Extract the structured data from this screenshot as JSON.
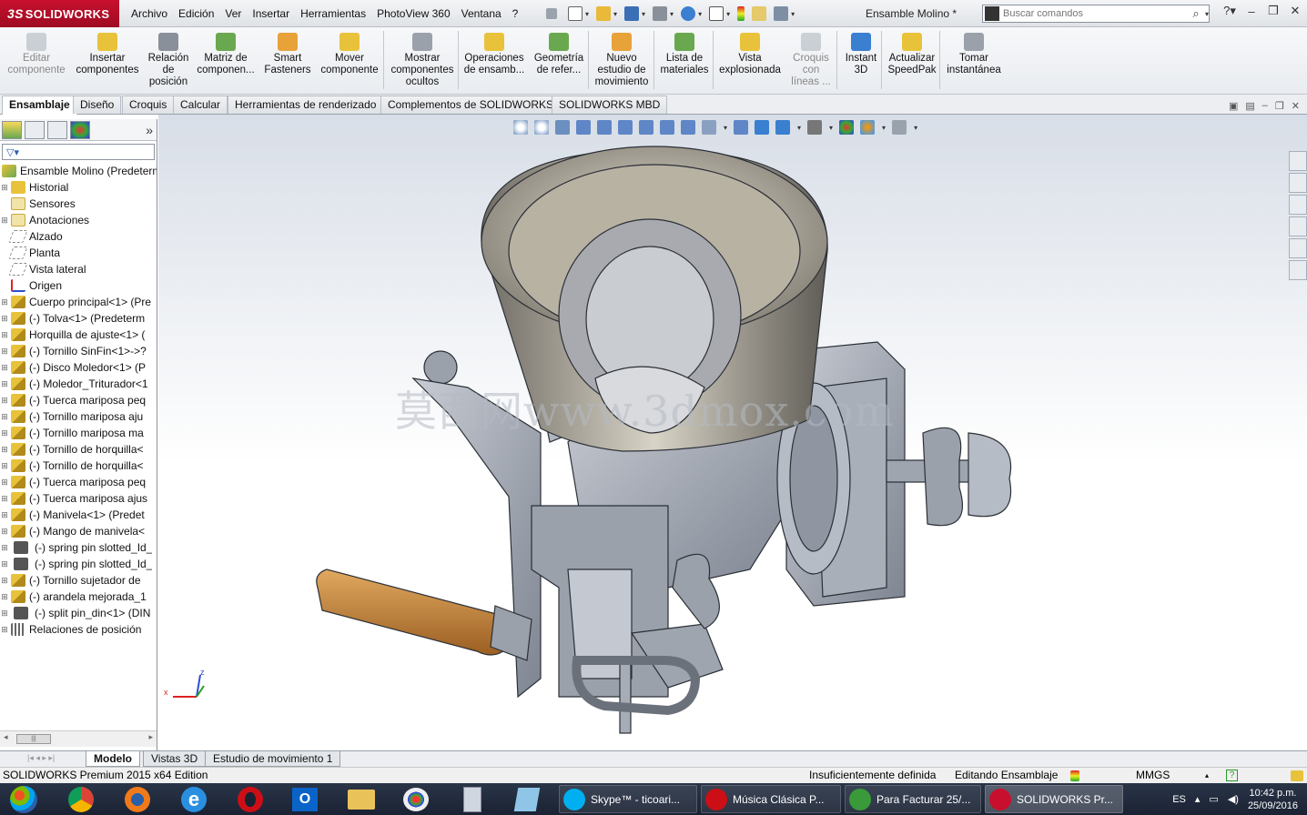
{
  "app": {
    "brand": "SOLIDWORKS",
    "brand_prefix": "3S",
    "document_title": "Ensamble Molino *"
  },
  "menus": [
    "Archivo",
    "Edición",
    "Ver",
    "Insertar",
    "Herramientas",
    "PhotoView 360",
    "Ventana",
    "?"
  ],
  "search": {
    "placeholder": "Buscar comandos"
  },
  "ribbon": [
    {
      "label": "Editar\ncomponente",
      "disabled": true,
      "icon": "edit-component-icon"
    },
    {
      "label": "Insertar\ncomponentes",
      "icon": "insert-components-icon"
    },
    {
      "label": "Relación\nde\nposición",
      "icon": "mate-icon"
    },
    {
      "label": "Matriz de\ncomponen...",
      "icon": "component-pattern-icon"
    },
    {
      "label": "Smart\nFasteners",
      "icon": "smart-fasteners-icon"
    },
    {
      "label": "Mover\ncomponente",
      "icon": "move-component-icon"
    },
    {
      "label": "Mostrar\ncomponentes\nocultos",
      "icon": "show-hidden-icon"
    },
    {
      "label": "Operaciones\nde ensamb...",
      "icon": "assembly-features-icon"
    },
    {
      "label": "Geometría\nde refer...",
      "icon": "reference-geometry-icon"
    },
    {
      "label": "Nuevo\nestudio de\nmovimiento",
      "icon": "motion-study-icon"
    },
    {
      "label": "Lista de\nmateriales",
      "icon": "bom-icon"
    },
    {
      "label": "Vista\nexplosionada",
      "icon": "exploded-view-icon"
    },
    {
      "label": "Croquis\ncon\nlíneas ...",
      "disabled": true,
      "icon": "explode-line-sketch-icon"
    },
    {
      "label": "Instant\n3D",
      "icon": "instant3d-icon"
    },
    {
      "label": "Actualizar\nSpeedPak",
      "icon": "speedpak-icon"
    },
    {
      "label": "Tomar\ninstantánea",
      "icon": "snapshot-icon"
    }
  ],
  "tabs": [
    "Ensamblaje",
    "Diseño",
    "Croquis",
    "Calcular",
    "Herramientas de renderizado",
    "Complementos de SOLIDWORKS",
    "SOLIDWORKS MBD"
  ],
  "feature_tree": {
    "root": "Ensamble Molino  (Predeterm",
    "items": [
      {
        "label": "Historial",
        "icon": "history-icon",
        "expand": true
      },
      {
        "label": "Sensores",
        "icon": "sensors-icon",
        "expand": false
      },
      {
        "label": "Anotaciones",
        "icon": "annotations-icon",
        "expand": true
      },
      {
        "label": "Alzado",
        "icon": "plane-icon",
        "expand": false
      },
      {
        "label": "Planta",
        "icon": "plane-icon",
        "expand": false
      },
      {
        "label": "Vista lateral",
        "icon": "plane-icon",
        "expand": false
      },
      {
        "label": "Origen",
        "icon": "origin-icon",
        "expand": false
      },
      {
        "label": "Cuerpo principal<1> (Pre",
        "icon": "part-icon",
        "expand": true
      },
      {
        "label": "(-) Tolva<1> (Predeterm",
        "icon": "part-icon",
        "expand": true
      },
      {
        "label": "Horquilla de ajuste<1> (",
        "icon": "part-icon",
        "expand": true
      },
      {
        "label": "(-) Tornillo SinFin<1>->?",
        "icon": "part-icon",
        "expand": true
      },
      {
        "label": "(-) Disco Moledor<1> (P",
        "icon": "part-icon",
        "expand": true
      },
      {
        "label": "(-) Moledor_Triturador<1",
        "icon": "part-icon",
        "expand": true
      },
      {
        "label": "(-) Tuerca mariposa peq",
        "icon": "part-icon",
        "expand": true
      },
      {
        "label": "(-) Tornillo mariposa aju",
        "icon": "part-icon",
        "expand": true
      },
      {
        "label": "(-) Tornillo mariposa ma",
        "icon": "part-icon",
        "expand": true
      },
      {
        "label": "(-) Tornillo de horquilla<",
        "icon": "part-icon",
        "expand": true
      },
      {
        "label": "(-) Tornillo de horquilla<",
        "icon": "part-icon",
        "expand": true
      },
      {
        "label": "(-) Tuerca mariposa peq",
        "icon": "part-icon",
        "expand": true
      },
      {
        "label": "(-) Tuerca mariposa ajus",
        "icon": "part-icon",
        "expand": true
      },
      {
        "label": "(-) Manivela<1> (Predet",
        "icon": "part-icon",
        "expand": true
      },
      {
        "label": "(-) Mango de manivela<",
        "icon": "part-icon",
        "expand": true
      },
      {
        "label": "(-) spring pin slotted_Id_",
        "icon": "toolbox-part-icon",
        "expand": true
      },
      {
        "label": "(-) spring pin slotted_Id_",
        "icon": "toolbox-part-icon",
        "expand": true
      },
      {
        "label": "(-) Tornillo sujetador de",
        "icon": "part-icon",
        "expand": true
      },
      {
        "label": "(-) arandela  mejorada_1",
        "icon": "part-icon",
        "expand": true
      },
      {
        "label": "(-) split pin_din<1> (DIN",
        "icon": "toolbox-part-icon",
        "expand": true
      },
      {
        "label": "Relaciones de posición",
        "icon": "mates-folder-icon",
        "expand": true
      }
    ]
  },
  "viewport": {
    "watermark": "莫西网www.3dmox.com"
  },
  "bottom_tabs": [
    "Modelo",
    "Vistas 3D",
    "Estudio de movimiento 1"
  ],
  "status": {
    "left": "SOLIDWORKS Premium 2015 x64 Edition",
    "definition": "Insuficientemente definida",
    "mode": "Editando Ensamblaje",
    "units": "MMGS"
  },
  "taskbar": {
    "windows": [
      {
        "label": "Skype™ - ticoari...",
        "icon": "skype-icon",
        "color": "#00aff0"
      },
      {
        "label": "Música Clásica P...",
        "icon": "opera-icon",
        "color": "#cc0f16"
      },
      {
        "label": "Para Facturar 25/...",
        "icon": "chrome-icon",
        "color": "#3a9a3a"
      },
      {
        "label": "SOLIDWORKS Pr...",
        "icon": "solidworks-icon",
        "color": "#c8102e"
      }
    ],
    "lang": "ES",
    "time": "10:42 p.m.",
    "date": "25/09/2016"
  },
  "colors": {
    "accent": "#c8102e",
    "taskbar": "#1e2738",
    "part_yellow": "#e8c23a",
    "part_steel": "#8a8f98",
    "handle_wood": "#c98a3a"
  }
}
